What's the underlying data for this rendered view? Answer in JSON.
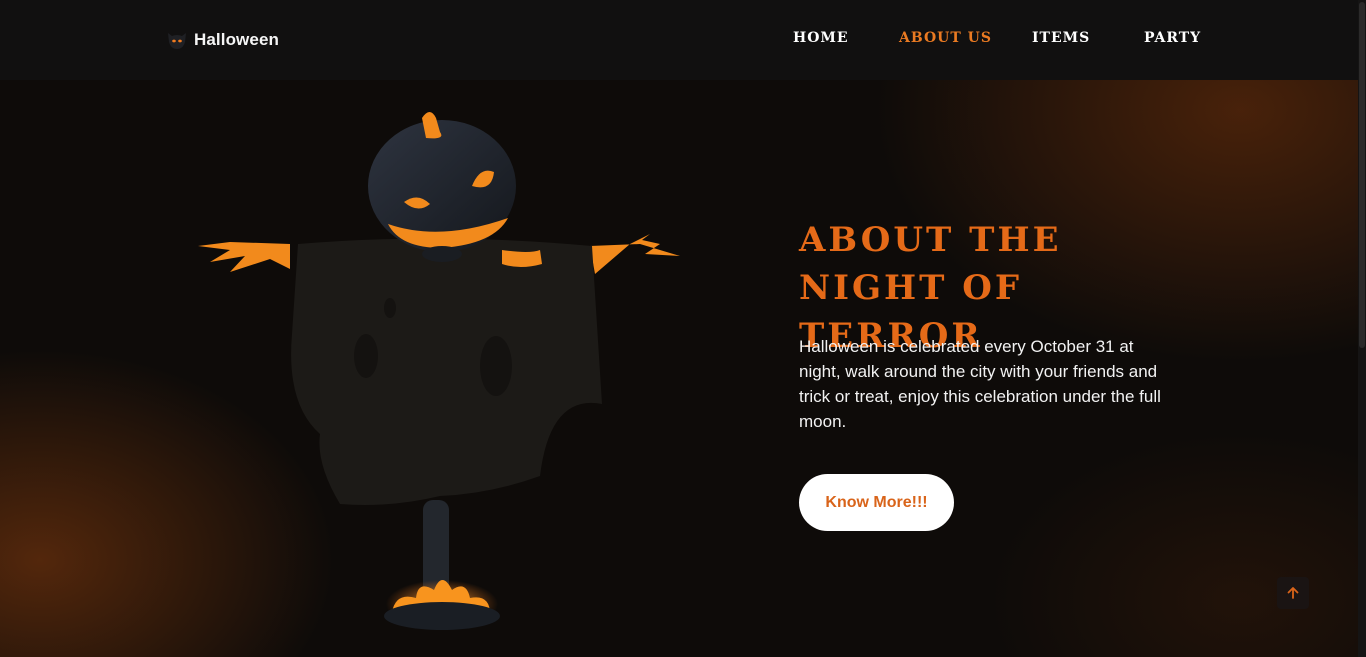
{
  "brand": {
    "name": "Halloween",
    "icon": "ghost-mask-icon"
  },
  "nav": {
    "items": [
      {
        "label": "Home",
        "active": false
      },
      {
        "label": "About Us",
        "active": true
      },
      {
        "label": "Items",
        "active": false
      },
      {
        "label": "Party",
        "active": false
      }
    ]
  },
  "hero": {
    "heading": "About the night of terror",
    "description": "Halloween is celebrated every October 31 at night, walk around the city with your friends and trick or treat, enjoy this celebration under the full moon.",
    "button_label": "Know More!!!",
    "figure": "pumpkin-scarecrow-illustration"
  },
  "scroll_top": {
    "icon": "arrow-up-icon"
  },
  "colors": {
    "accent": "#e56a18",
    "nav_active": "#ea7a22",
    "background": "#0e0b09",
    "header": "#111010",
    "button_bg": "#ffffff",
    "button_text": "#d9641a"
  }
}
